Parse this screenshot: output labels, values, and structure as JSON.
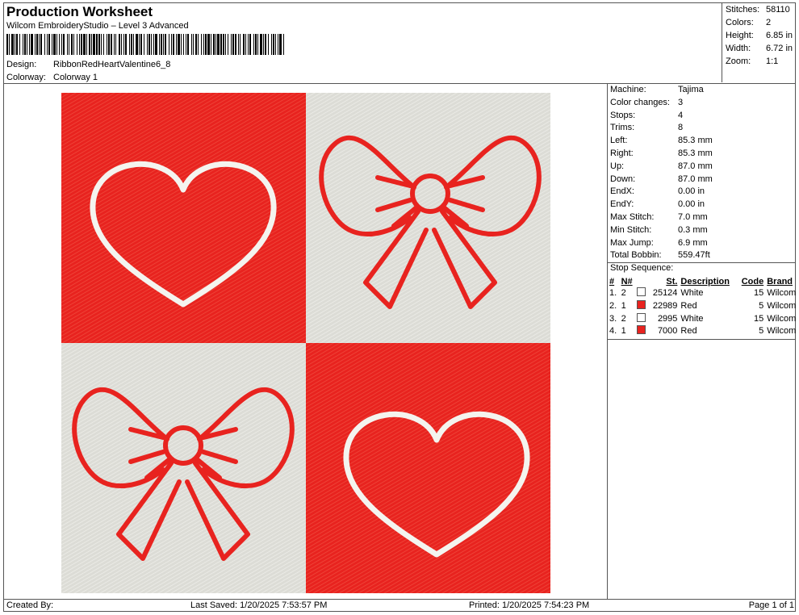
{
  "header": {
    "title": "Production Worksheet",
    "subtitle": "Wilcom EmbroideryStudio – Level 3 Advanced",
    "design_label": "Design:",
    "design_value": "RibbonRedHeartValentine6_8",
    "colorway_label": "Colorway:",
    "colorway_value": "Colorway 1"
  },
  "summary": [
    {
      "label": "Stitches:",
      "value": "58110"
    },
    {
      "label": "Colors:",
      "value": "2"
    },
    {
      "label": "Height:",
      "value": "6.85 in"
    },
    {
      "label": "Width:",
      "value": "6.72 in"
    },
    {
      "label": "Zoom:",
      "value": "1:1"
    }
  ],
  "stats": [
    {
      "label": "Machine:",
      "value": "Tajima"
    },
    {
      "label": "Color changes:",
      "value": "3"
    },
    {
      "label": "Stops:",
      "value": "4"
    },
    {
      "label": "Trims:",
      "value": "8"
    },
    {
      "label": "Left:",
      "value": "85.3 mm"
    },
    {
      "label": "Right:",
      "value": "85.3 mm"
    },
    {
      "label": "Up:",
      "value": "87.0 mm"
    },
    {
      "label": "Down:",
      "value": "87.0 mm"
    },
    {
      "label": "EndX:",
      "value": "0.00 in"
    },
    {
      "label": "EndY:",
      "value": "0.00 in"
    },
    {
      "label": "Max Stitch:",
      "value": "7.0 mm"
    },
    {
      "label": "Min Stitch:",
      "value": "0.3 mm"
    },
    {
      "label": "Max Jump:",
      "value": "6.9 mm"
    },
    {
      "label": "Total Bobbin:",
      "value": "559.47ft"
    }
  ],
  "stop_sequence": {
    "title": "Stop Sequence:",
    "headers": {
      "num": "#",
      "n": "N#",
      "st": "St.",
      "desc": "Description",
      "code": "Code",
      "brand": "Brand"
    },
    "rows": [
      {
        "num": "1.",
        "n": "2",
        "color": "#ffffff",
        "st": "25124",
        "desc": "White",
        "code": "15",
        "brand": "Wilcom"
      },
      {
        "num": "2.",
        "n": "1",
        "color": "#e8231f",
        "st": "22989",
        "desc": "Red",
        "code": "5",
        "brand": "Wilcom"
      },
      {
        "num": "3.",
        "n": "2",
        "color": "#ffffff",
        "st": "2995",
        "desc": "White",
        "code": "15",
        "brand": "Wilcom"
      },
      {
        "num": "4.",
        "n": "1",
        "color": "#e8231f",
        "st": "7000",
        "desc": "Red",
        "code": "5",
        "brand": "Wilcom"
      }
    ]
  },
  "footer": {
    "created": "Created By:",
    "last_saved": "Last Saved: 1/20/2025 7:53:57 PM",
    "printed": "Printed: 1/20/2025 7:54:23 PM",
    "page": "Page 1 of 1"
  },
  "colors": {
    "red": "#e8231f",
    "white_fabric": "#dcdcd6",
    "white_stitch": "#f2f2ee"
  }
}
